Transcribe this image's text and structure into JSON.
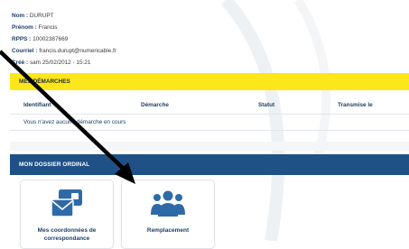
{
  "profile": {
    "nom_label": "Nom :",
    "nom_value": "DURUPT",
    "prenom_label": "Prénom :",
    "prenom_value": "Francis",
    "rpps_label": "RPPS :",
    "rpps_value": "10002387669",
    "courriel_label": "Courriel :",
    "courriel_value": "francis.durupt@numericable.fr",
    "cree_label": "Créé :",
    "cree_value": "sam 25/02/2012 - 15:21"
  },
  "demarches": {
    "title": "MES DÉMARCHES",
    "columns": [
      "Identifiant",
      "Démarche",
      "Statut",
      "Transmise le"
    ],
    "empty_message": "Vous n'avez aucune démarche en cours"
  },
  "dossier": {
    "title": "MON DOSSIER ORDINAL",
    "tiles": [
      {
        "label": "Mes coordonnées de correspondance",
        "icon": "contact-card-envelope-icon"
      },
      {
        "label": "Remplacement",
        "icon": "group-people-icon"
      }
    ]
  },
  "colors": {
    "yellow_header": "#fde619",
    "blue_header": "#1f5186",
    "icon_blue": "#2f6aa8",
    "text_navy": "#1e3f66"
  }
}
